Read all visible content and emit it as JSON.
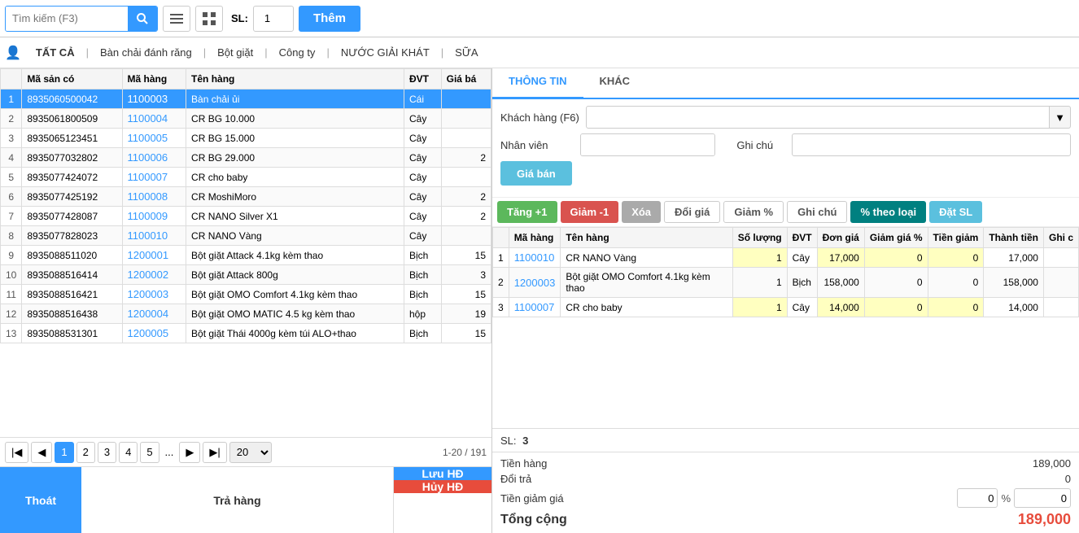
{
  "topbar": {
    "search_placeholder": "Tìm kiếm (F3)",
    "sl_label": "SL:",
    "sl_value": "1",
    "them_label": "Thêm"
  },
  "categories": {
    "icon": "👤",
    "items": [
      {
        "id": "all",
        "label": "TẤT CẢ",
        "active": true
      },
      {
        "id": "banchai",
        "label": "Bàn chải đánh răng"
      },
      {
        "id": "botgiat",
        "label": "Bột giặt"
      },
      {
        "id": "congty",
        "label": "Công ty"
      },
      {
        "id": "nuocgiaikh",
        "label": "NƯỚC GIẢI KHÁT"
      },
      {
        "id": "sua",
        "label": "SỮA"
      }
    ]
  },
  "product_table": {
    "headers": [
      "Mã sản có",
      "Mã hàng",
      "Tên hàng",
      "ĐVT",
      "Giá bá"
    ],
    "rows": [
      {
        "num": 1,
        "barcode": "8935060500042",
        "code": "1100003",
        "name": "Bàn chải ủi",
        "unit": "Cái",
        "price": "",
        "selected": true
      },
      {
        "num": 2,
        "barcode": "8935061800509",
        "code": "1100004",
        "name": "CR BG 10.000",
        "unit": "Cây",
        "price": ""
      },
      {
        "num": 3,
        "barcode": "8935065123451",
        "code": "1100005",
        "name": "CR BG 15.000",
        "unit": "Cây",
        "price": ""
      },
      {
        "num": 4,
        "barcode": "8935077032802",
        "code": "1100006",
        "name": "CR BG 29.000",
        "unit": "Cây",
        "price": "2"
      },
      {
        "num": 5,
        "barcode": "8935077424072",
        "code": "1100007",
        "name": "CR cho baby",
        "unit": "Cây",
        "price": ""
      },
      {
        "num": 6,
        "barcode": "8935077425192",
        "code": "1100008",
        "name": "CR MoshiMoro",
        "unit": "Cây",
        "price": "2"
      },
      {
        "num": 7,
        "barcode": "8935077428087",
        "code": "1100009",
        "name": "CR NANO Silver X1",
        "unit": "Cây",
        "price": "2"
      },
      {
        "num": 8,
        "barcode": "8935077828023",
        "code": "1100010",
        "name": "CR NANO Vàng",
        "unit": "Cây",
        "price": ""
      },
      {
        "num": 9,
        "barcode": "8935088511020",
        "code": "1200001",
        "name": "Bột giặt Attack 4.1kg kèm thao",
        "unit": "Bịch",
        "price": "15"
      },
      {
        "num": 10,
        "barcode": "8935088516414",
        "code": "1200002",
        "name": "Bột giặt Attack 800g",
        "unit": "Bịch",
        "price": "3"
      },
      {
        "num": 11,
        "barcode": "8935088516421",
        "code": "1200003",
        "name": "Bột giặt OMO Comfort 4.1kg kèm thao",
        "unit": "Bịch",
        "price": "15"
      },
      {
        "num": 12,
        "barcode": "8935088516438",
        "code": "1200004",
        "name": "Bột giặt OMO MATIC 4.5 kg kèm thao",
        "unit": "hộp",
        "price": "19"
      },
      {
        "num": 13,
        "barcode": "8935088531301",
        "code": "1200005",
        "name": "Bột giặt Thái 4000g kèm túi ALO+thao",
        "unit": "Bịch",
        "price": "15"
      }
    ]
  },
  "pagination": {
    "pages": [
      "1",
      "2",
      "3",
      "4",
      "5"
    ],
    "current": "1",
    "page_size": "20",
    "info": "1-20 / 191"
  },
  "bottom_buttons": {
    "thoat": "Thoát",
    "tra_hang": "Trả hàng",
    "luu_hd": "Lưu HĐ",
    "huy_hd": "Hủy HĐ"
  },
  "right_panel": {
    "tabs": [
      {
        "id": "thongtin",
        "label": "THÔNG TIN",
        "active": true
      },
      {
        "id": "khac",
        "label": "KHÁC"
      }
    ],
    "form": {
      "khach_hang_label": "Khách hàng (F6)",
      "khach_hang_value": "",
      "nhan_vien_label": "Nhân viên",
      "nhan_vien_value": "",
      "ghi_chu_label": "Ghi chú",
      "ghi_chu_value": "",
      "gia_ban_label": "Giá bán"
    },
    "action_buttons": [
      {
        "id": "tang1",
        "label": "Tăng +1",
        "style": "green"
      },
      {
        "id": "giam1",
        "label": "Giảm -1",
        "style": "red"
      },
      {
        "id": "xoa",
        "label": "Xóa",
        "style": "gray"
      },
      {
        "id": "doigia",
        "label": "Đổi giá",
        "style": "blue-outline"
      },
      {
        "id": "giam_pct",
        "label": "Giảm %",
        "style": "blue-outline"
      },
      {
        "id": "ghichu",
        "label": "Ghi chú",
        "style": "blue-outline"
      },
      {
        "id": "pct_theo_loai",
        "label": "% theo loại",
        "style": "teal"
      },
      {
        "id": "dat_sl",
        "label": "Đặt SL",
        "style": "blue"
      }
    ],
    "order_table": {
      "headers": [
        "",
        "Mã hàng",
        "Tên hàng",
        "Số lượng",
        "ĐVT",
        "Đơn giá",
        "Giảm giá %",
        "Tiền giảm",
        "Thành tiền",
        "Ghi c"
      ],
      "rows": [
        {
          "num": 1,
          "code": "1100010",
          "name": "CR NANO Vàng",
          "qty": 1,
          "unit": "Cây",
          "price": "17,000",
          "discount_pct": 0,
          "discount_val": 0,
          "total": "17,000"
        },
        {
          "num": 2,
          "code": "1200003",
          "name": "Bột giặt OMO Comfort 4.1kg kèm thao",
          "qty": 1,
          "unit": "Bịch",
          "price": "158,000",
          "discount_pct": 0,
          "discount_val": 0,
          "total": "158,000"
        },
        {
          "num": 3,
          "code": "1100007",
          "name": "CR cho baby",
          "qty": 1,
          "unit": "Cây",
          "price": "14,000",
          "discount_pct": 0,
          "discount_val": 0,
          "total": "14,000"
        }
      ]
    },
    "summary": {
      "sl_label": "SL:",
      "sl_value": "3"
    },
    "totals": {
      "tien_hang_label": "Tiền hàng",
      "tien_hang_value": "189,000",
      "doi_tra_label": "Đổi trả",
      "doi_tra_value": "0",
      "tien_giam_label": "Tiền giảm giá",
      "tien_giam_pct": "0",
      "tien_giam_unit": "%",
      "tien_giam_value": "0",
      "tong_cong_label": "Tổng cộng",
      "tong_cong_value": "189,000"
    }
  }
}
